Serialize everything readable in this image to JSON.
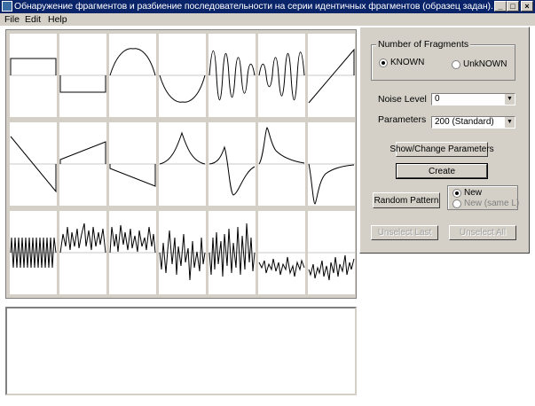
{
  "window": {
    "title": "Обнаружение фрагментов и разбиение последовательности на серии идентичных фрагментов (образец задан).",
    "minimize": "_",
    "maximize": "□",
    "close": "×"
  },
  "menu": {
    "file": "File",
    "edit": "Edit",
    "help": "Help"
  },
  "controls": {
    "fragments_group": "Number of Fragments",
    "known_label": "KNOWN",
    "unknown_label": "UnkNOWN",
    "known_selected": true,
    "noise_label": "Noise Level",
    "noise_value": "0",
    "params_label": "Parameters",
    "params_value": "200 (Standard)",
    "show_change_btn": "Show/Change Parameters",
    "create_btn": "Create",
    "random_btn": "Random Pattern",
    "new_label": "New",
    "new_same_label": "New (same L)",
    "unselect_last_btn": "Unselect Last",
    "unselect_all_btn": "Unselect All"
  },
  "patterns": {
    "rows": [
      [
        "rect-high",
        "rect-low",
        "sine-half-pos",
        "sine-half-neg",
        "chirp-a",
        "chirp-b",
        "ramp-up"
      ],
      [
        "ramp-down",
        "slope-pos",
        "slope-neg",
        "peak-pos",
        "peak-neg",
        "spike-pos",
        "spike-neg"
      ],
      [
        "square-osc",
        "noise-a",
        "noise-b",
        "noise-c",
        "noise-d",
        "noise-e",
        "noise-f"
      ]
    ]
  }
}
